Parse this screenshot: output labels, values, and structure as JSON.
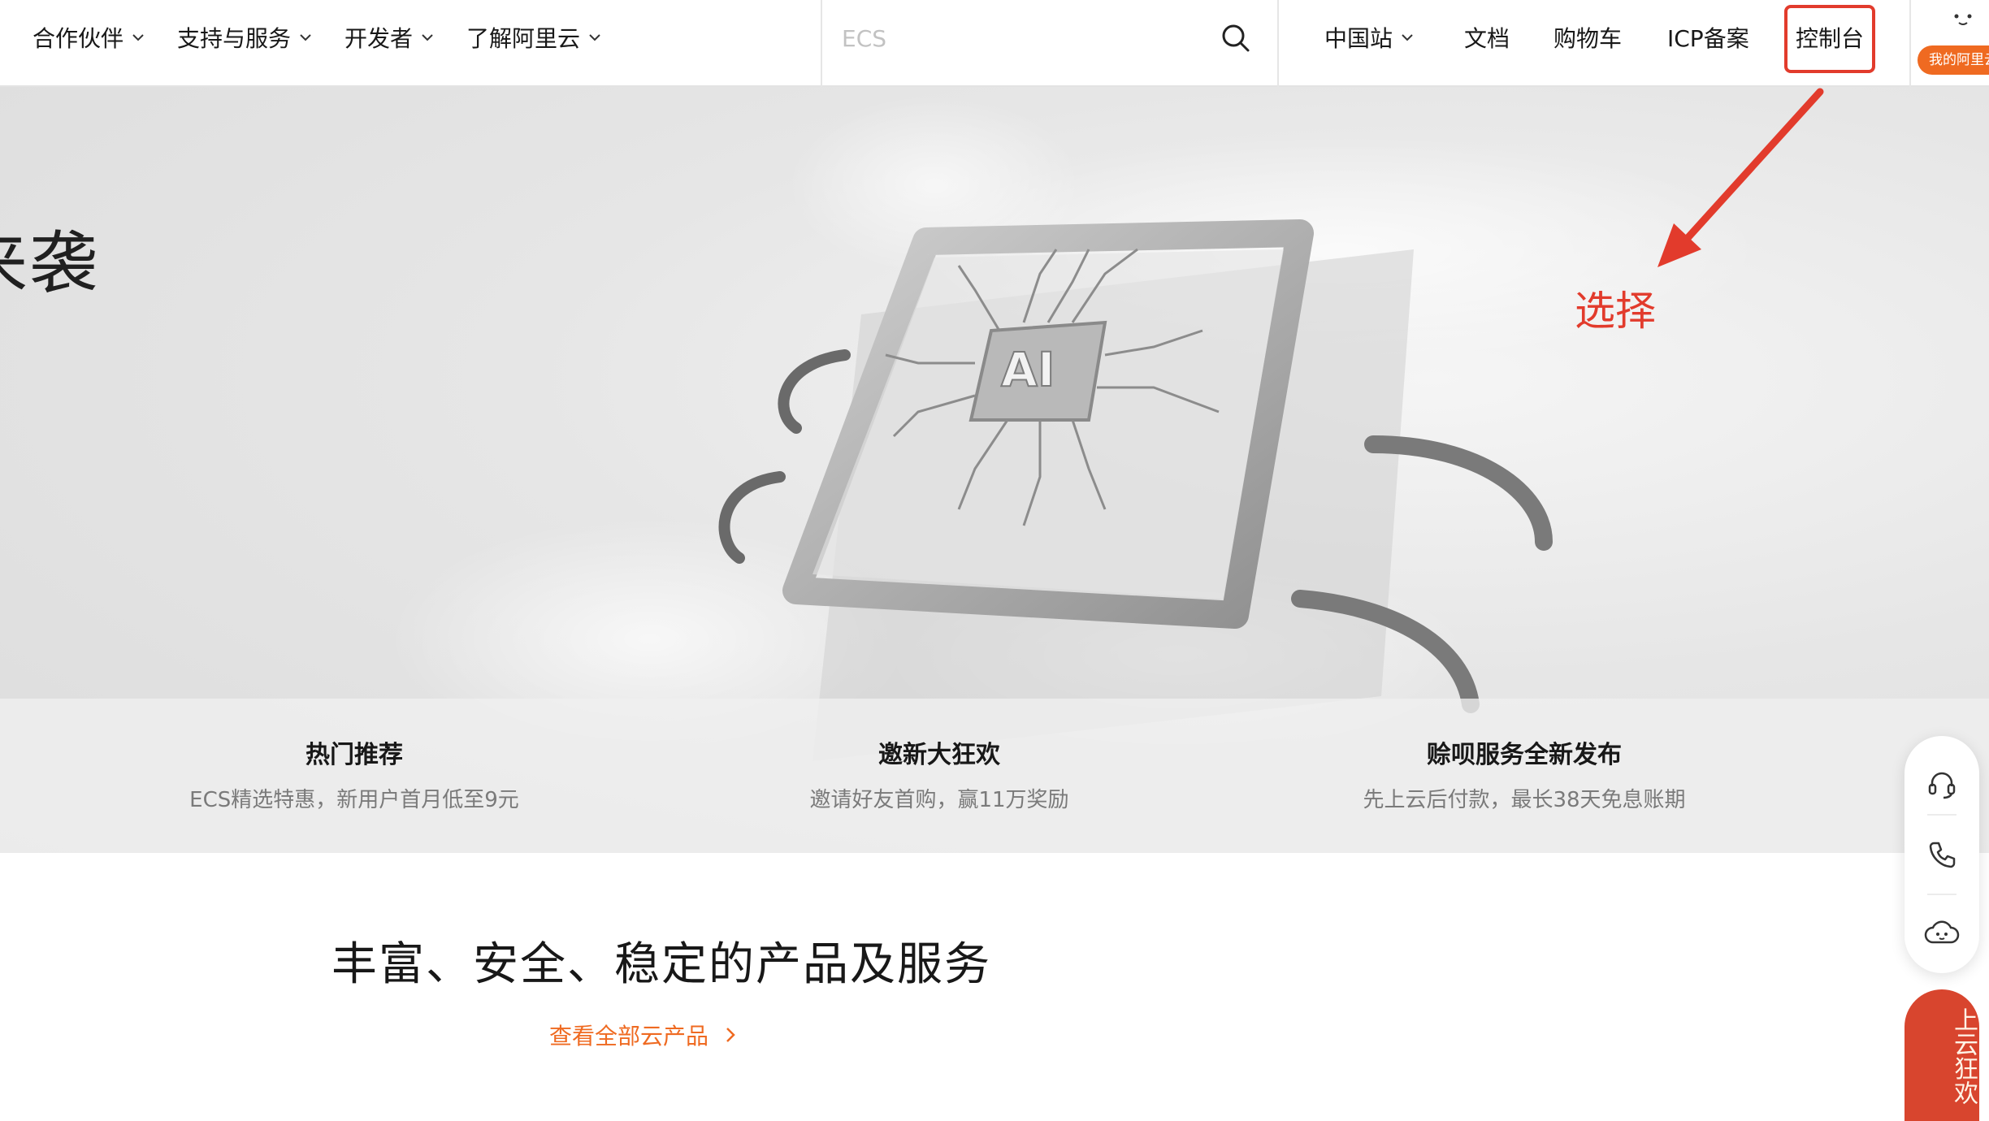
{
  "nav": {
    "left_items": [
      "合作伙伴",
      "支持与服务",
      "开发者",
      "了解阿里云"
    ],
    "search": {
      "placeholder": "ECS"
    },
    "right_items": {
      "region": "中国站",
      "docs": "文档",
      "cart": "购物车",
      "icp": "ICP备案",
      "console": "控制台"
    },
    "avatar_badge": "我的阿里云"
  },
  "hero": {
    "title_fragment": "来袭",
    "chip_label": "AI",
    "annotation": "选择",
    "promos": [
      {
        "title": "热门推荐",
        "desc": "ECS精选特惠，新用户首月低至9元"
      },
      {
        "title": "邀新大狂欢",
        "desc": "邀请好友首购，赢11万奖励"
      },
      {
        "title": "赊呗服务全新发布",
        "desc": "先上云后付款，最长38天免息账期"
      }
    ]
  },
  "products": {
    "title": "丰富、安全、稳定的产品及服务",
    "link": "查看全部云产品"
  },
  "float_bar": {
    "icons": [
      "headset-icon",
      "phone-icon",
      "cloud-face-icon"
    ],
    "promo_tab": "上云狂欢"
  },
  "colors": {
    "accent": "#ef6a21",
    "annotation_red": "#e23b2c",
    "promo_tab": "#d8452e"
  }
}
